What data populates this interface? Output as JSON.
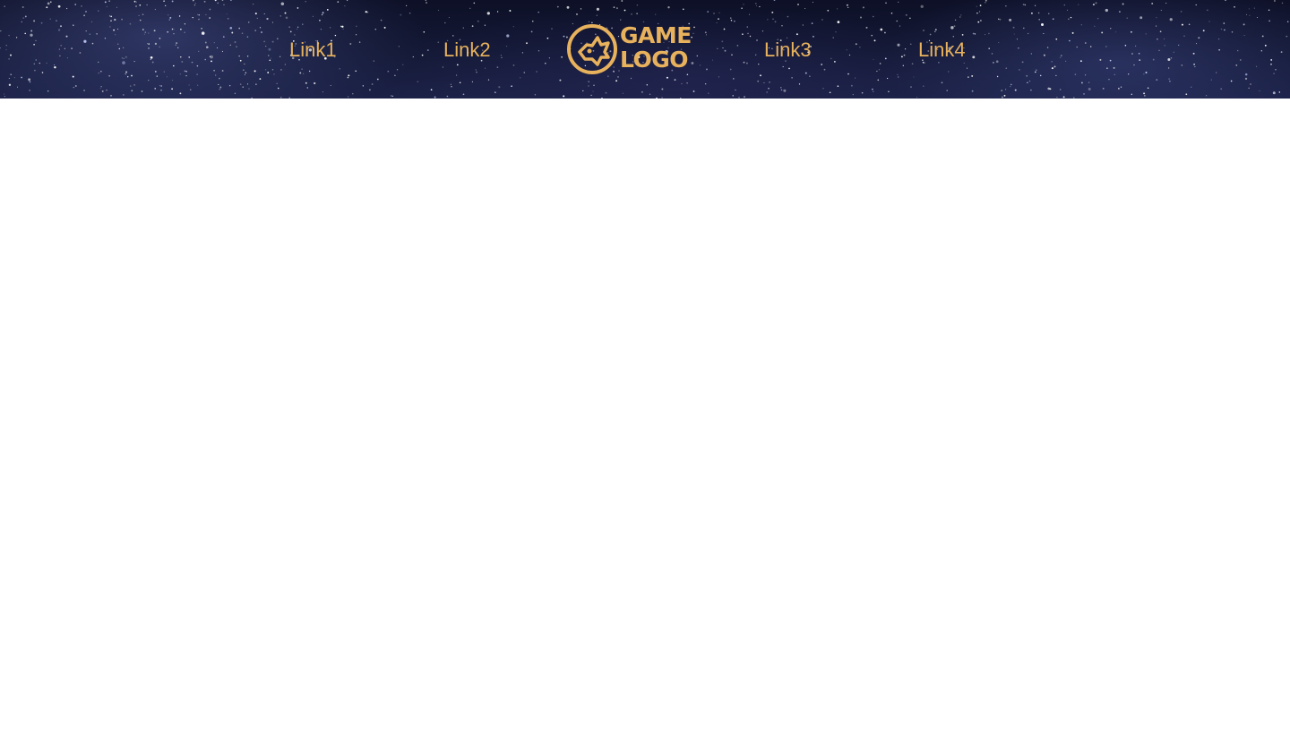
{
  "header": {
    "background": "starfield",
    "accent_color": "#e8b25d",
    "links": [
      {
        "label": "Link1"
      },
      {
        "label": "Link2"
      },
      {
        "label": "Link3"
      },
      {
        "label": "Link4"
      }
    ],
    "logo": {
      "icon": "wolf-head-icon",
      "line1": "GAME",
      "line2": "LOGO"
    }
  }
}
